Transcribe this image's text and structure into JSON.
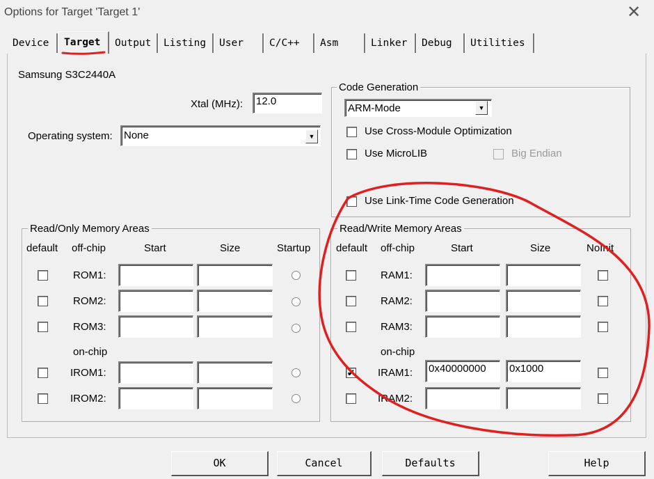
{
  "window": {
    "title": "Options for Target 'Target 1'"
  },
  "tabs": [
    "Device",
    "Target",
    "Output",
    "Listing",
    "User",
    "C/C++",
    "Asm",
    "Linker",
    "Debug",
    "Utilities"
  ],
  "target": {
    "device_name": "Samsung S3C2440A",
    "xtal_label": "Xtal (MHz):",
    "xtal_value": "12.0",
    "os_label": "Operating system:",
    "os_value": "None"
  },
  "code_generation": {
    "legend": "Code Generation",
    "mode_value": "ARM-Mode",
    "cross_module_label": "Use Cross-Module Optimization",
    "microlib_label": "Use MicroLIB",
    "big_endian_label": "Big Endian",
    "ltcg_label": "Use Link-Time Code Generation"
  },
  "readonly": {
    "legend": "Read/Only Memory Areas",
    "headers": {
      "default": "default",
      "offchip": "off-chip",
      "start": "Start",
      "size": "Size",
      "startup": "Startup"
    },
    "onchip_label": "on-chip",
    "rows": [
      {
        "label": "ROM1:",
        "start": "",
        "size": "",
        "default": false
      },
      {
        "label": "ROM2:",
        "start": "",
        "size": "",
        "default": false
      },
      {
        "label": "ROM3:",
        "start": "",
        "size": "",
        "default": false
      },
      {
        "label": "IROM1:",
        "start": "",
        "size": "",
        "default": false
      },
      {
        "label": "IROM2:",
        "start": "",
        "size": "",
        "default": false
      }
    ]
  },
  "readwrite": {
    "legend": "Read/Write Memory Areas",
    "headers": {
      "default": "default",
      "offchip": "off-chip",
      "start": "Start",
      "size": "Size",
      "noinit": "NoInit"
    },
    "onchip_label": "on-chip",
    "rows": [
      {
        "label": "RAM1:",
        "start": "",
        "size": "",
        "default": false,
        "noinit": false
      },
      {
        "label": "RAM2:",
        "start": "",
        "size": "",
        "default": false,
        "noinit": false
      },
      {
        "label": "RAM3:",
        "start": "",
        "size": "",
        "default": false,
        "noinit": false
      },
      {
        "label": "IRAM1:",
        "start": "0x40000000",
        "size": "0x1000",
        "default": true,
        "noinit": false
      },
      {
        "label": "IRAM2:",
        "start": "",
        "size": "",
        "default": false,
        "noinit": false
      }
    ]
  },
  "buttons": {
    "ok": "OK",
    "cancel": "Cancel",
    "defaults": "Defaults",
    "help": "Help"
  },
  "annotation_color": "#e02020"
}
